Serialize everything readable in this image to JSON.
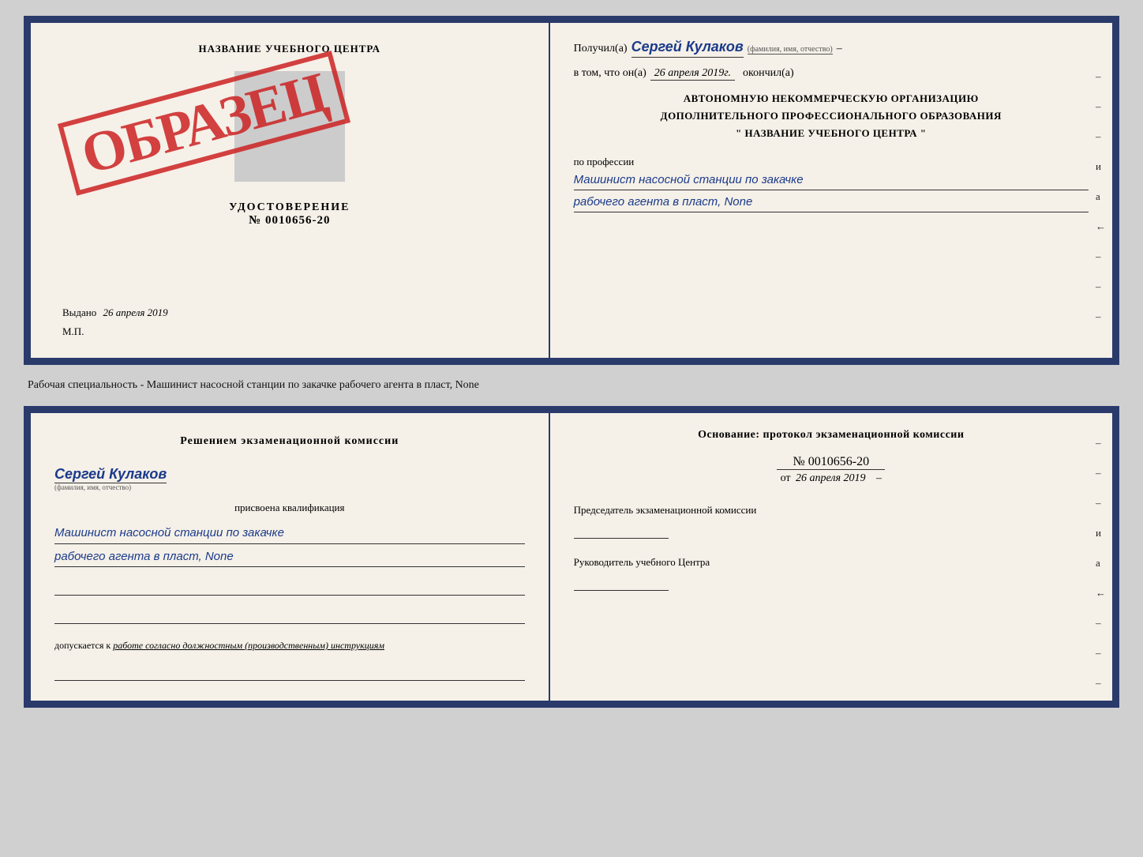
{
  "top_left": {
    "training_center": "НАЗВАНИЕ УЧЕБНОГО ЦЕНТРА",
    "udostoverenie_label": "УДОСТОВЕРЕНИЕ",
    "number": "№ 0010656-20",
    "vydano_label": "Выдано",
    "vydano_date": "26 апреля 2019",
    "mp_label": "М.П.",
    "obrazets": "ОБРАЗЕЦ"
  },
  "top_right": {
    "poluchil_label": "Получил(а)",
    "recipient_name": "Сергей Кулаков",
    "fio_hint": "(фамилия, имя, отчество)",
    "v_tom_chto": "в том, что он(а)",
    "date_value": "26 апреля 2019г.",
    "okonchil_label": "окончил(а)",
    "org_line1": "АВТОНОМНУЮ НЕКОММЕРЧЕСКУЮ ОРГАНИЗАЦИЮ",
    "org_line2": "ДОПОЛНИТЕЛЬНОГО ПРОФЕССИОНАЛЬНОГО ОБРАЗОВАНИЯ",
    "org_line3": "\" НАЗВАНИЕ УЧЕБНОГО ЦЕНТРА \"",
    "po_professii": "по профессии",
    "profession_line1": "Машинист насосной станции по закачке",
    "profession_line2": "рабочего агента в пласт, None"
  },
  "separator": {
    "text": "Рабочая специальность - Машинист насосной станции по закачке рабочего агента в пласт, None"
  },
  "bottom_left": {
    "commission_title": "Решением экзаменационной комиссии",
    "person_name": "Сергей Кулаков",
    "fio_hint": "(фамилия, имя, отчество)",
    "prisvoena": "присвоена квалификация",
    "kvali_line1": "Машинист насосной станции по закачке",
    "kvali_line2": "рабочего агента в пласт, None",
    "dopuskaetsya_label": "допускается к",
    "dopuskaetsya_value": "работе согласно должностным (производственным) инструкциям"
  },
  "bottom_right": {
    "osnovaniye": "Основание: протокол экзаменационной комиссии",
    "protocol_number": "№ 0010656-20",
    "ot_label": "от",
    "ot_date": "26 апреля 2019",
    "predsedatel_label": "Председатель экзаменационной комиссии",
    "rukovoditel_label": "Руководитель учебного Центра"
  },
  "right_margin": {
    "marks": [
      "–",
      "–",
      "–",
      "и",
      "а",
      "←",
      "–",
      "–",
      "–"
    ]
  }
}
